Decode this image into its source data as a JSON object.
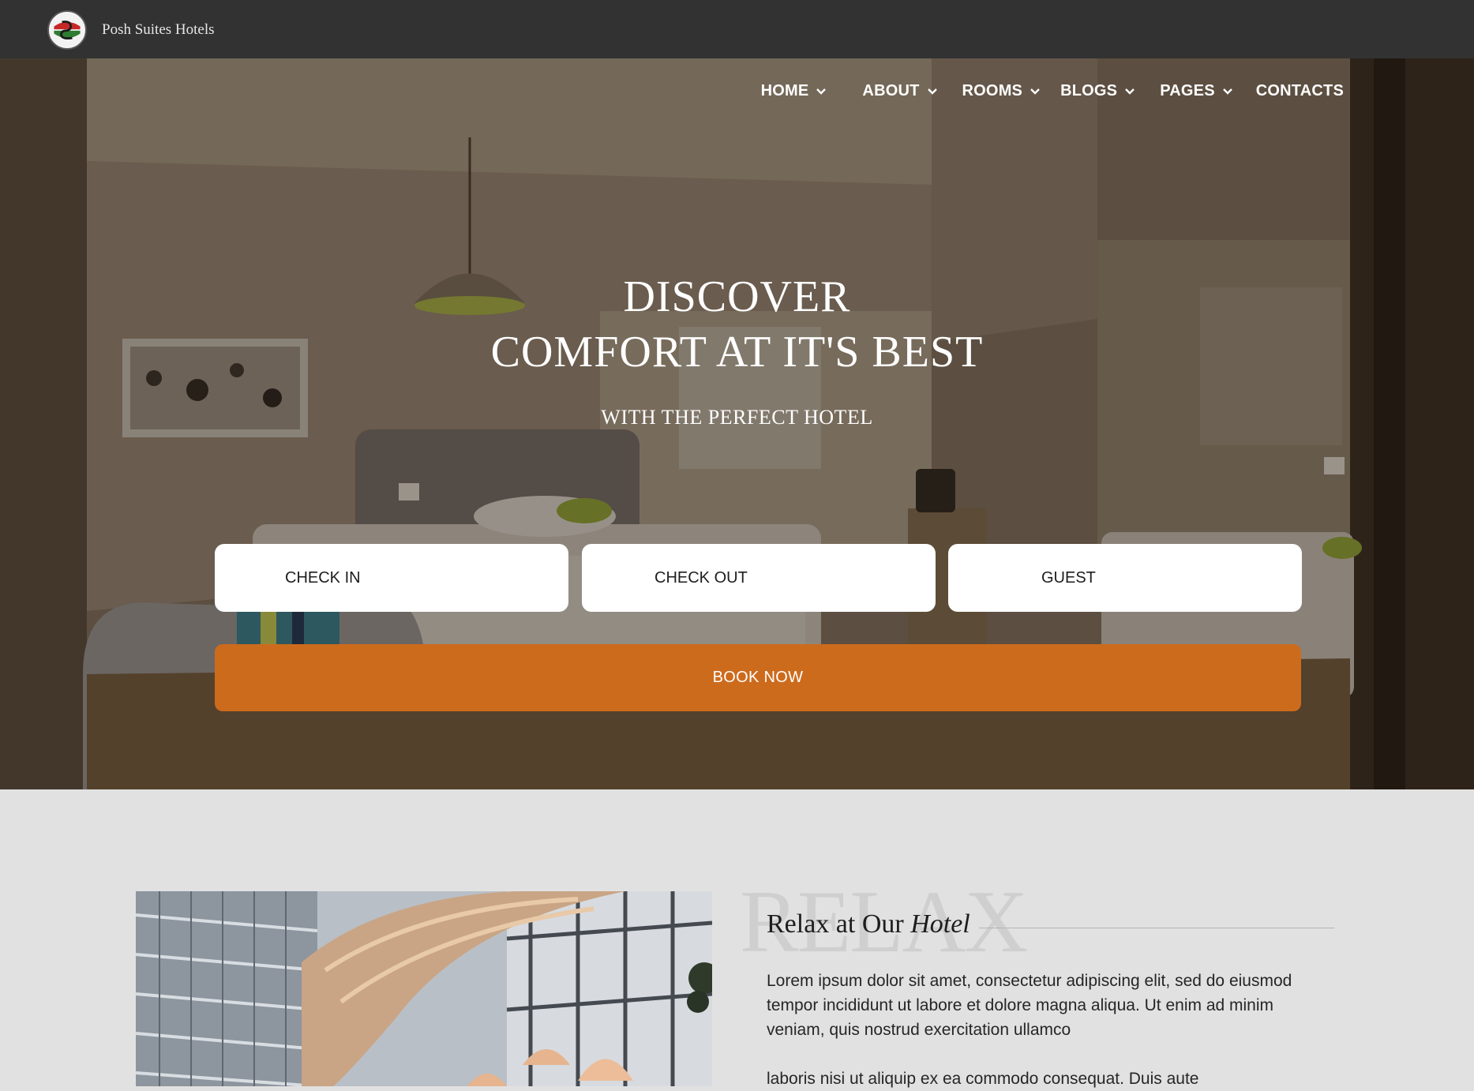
{
  "header": {
    "brand": "Posh Suites Hotels",
    "logo_icon": "hotel-crest-icon"
  },
  "nav": {
    "items": [
      {
        "label": "HOME",
        "has_dropdown": true
      },
      {
        "label": "ABOUT",
        "has_dropdown": true
      },
      {
        "label": "ROOMS",
        "has_dropdown": true
      },
      {
        "label": "BLOGS",
        "has_dropdown": true
      },
      {
        "label": "PAGES",
        "has_dropdown": true
      },
      {
        "label": "CONTACTS",
        "has_dropdown": false
      }
    ]
  },
  "hero": {
    "title_line1": "DISCOVER",
    "title_line2": "COMFORT AT IT'S BEST",
    "subtitle": "WITH THE PERFECT HOTEL"
  },
  "booking": {
    "check_in_label": "CHECK IN",
    "check_out_label": "CHECK OUT",
    "guest_label": "GUEST",
    "book_now_label": "BOOK NOW"
  },
  "about": {
    "watermark": "RELAX",
    "title_plain": "Relax at Our ",
    "title_italic": "Hotel",
    "paragraph1": "Lorem ipsum dolor sit amet, consectetur adipiscing elit, sed do eiusmod tempor incididunt ut labore et dolore magna aliqua. Ut enim ad minim veniam, quis nostrud exercitation ullamco",
    "paragraph2": "laboris nisi ut aliquip ex ea commodo consequat. Duis aute"
  },
  "colors": {
    "topbar": "#323232",
    "accent": "#cd6b1d",
    "page_bg": "#e1e1e1"
  }
}
